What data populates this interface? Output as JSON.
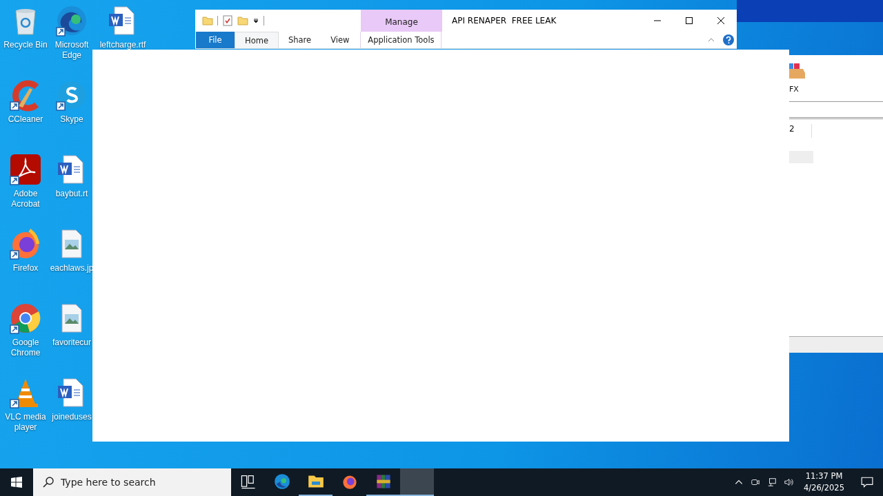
{
  "desktop_icons": [
    {
      "label": "Recycle Bin",
      "kind": "recycle",
      "shortcut": false
    },
    {
      "label": "CCleaner",
      "kind": "ccleaner",
      "shortcut": true
    },
    {
      "label": "Adobe Acrobat",
      "kind": "acrobat",
      "shortcut": true
    },
    {
      "label": "Firefox",
      "kind": "firefox",
      "shortcut": true
    },
    {
      "label": "Google Chrome",
      "kind": "chrome",
      "shortcut": true
    },
    {
      "label": "VLC media player",
      "kind": "vlc",
      "shortcut": true
    },
    {
      "label": "Microsoft Edge",
      "kind": "edge",
      "shortcut": true
    },
    {
      "label": "Skype",
      "kind": "skype",
      "shortcut": true
    },
    {
      "label": "baybut.rt",
      "kind": "word",
      "shortcut": false
    },
    {
      "label": "eachlaws.jp",
      "kind": "image",
      "shortcut": false
    },
    {
      "label": "favoritecur",
      "kind": "image",
      "shortcut": false
    },
    {
      "label": "joineduses",
      "kind": "word",
      "shortcut": false
    },
    {
      "label": "leftcharge.rtf",
      "kind": "word",
      "shortcut": false
    }
  ],
  "explorer": {
    "title": "API RENAPER  FREE LEAK",
    "context_tab": "Manage",
    "tabs": [
      {
        "label": "File",
        "kind": "file",
        "selected": false
      },
      {
        "label": "Home",
        "kind": "normal",
        "selected": true
      },
      {
        "label": "Share",
        "kind": "normal",
        "selected": false
      },
      {
        "label": "View",
        "kind": "normal",
        "selected": false
      },
      {
        "label": "Application Tools",
        "kind": "context",
        "selected": false
      }
    ]
  },
  "back_window": {
    "icon_label": "FX",
    "cell": "2"
  },
  "taskbar": {
    "search_placeholder": "Type here to search",
    "apps": [
      {
        "kind": "taskview",
        "running": false,
        "active": false
      },
      {
        "kind": "edge",
        "running": false,
        "active": false
      },
      {
        "kind": "explorer",
        "running": true,
        "active": false
      },
      {
        "kind": "firefox",
        "running": false,
        "active": false
      },
      {
        "kind": "winrar",
        "running": true,
        "active": false
      },
      {
        "kind": "blank",
        "running": true,
        "active": true
      }
    ],
    "time": "11:37 PM",
    "date": "4/26/2025"
  }
}
